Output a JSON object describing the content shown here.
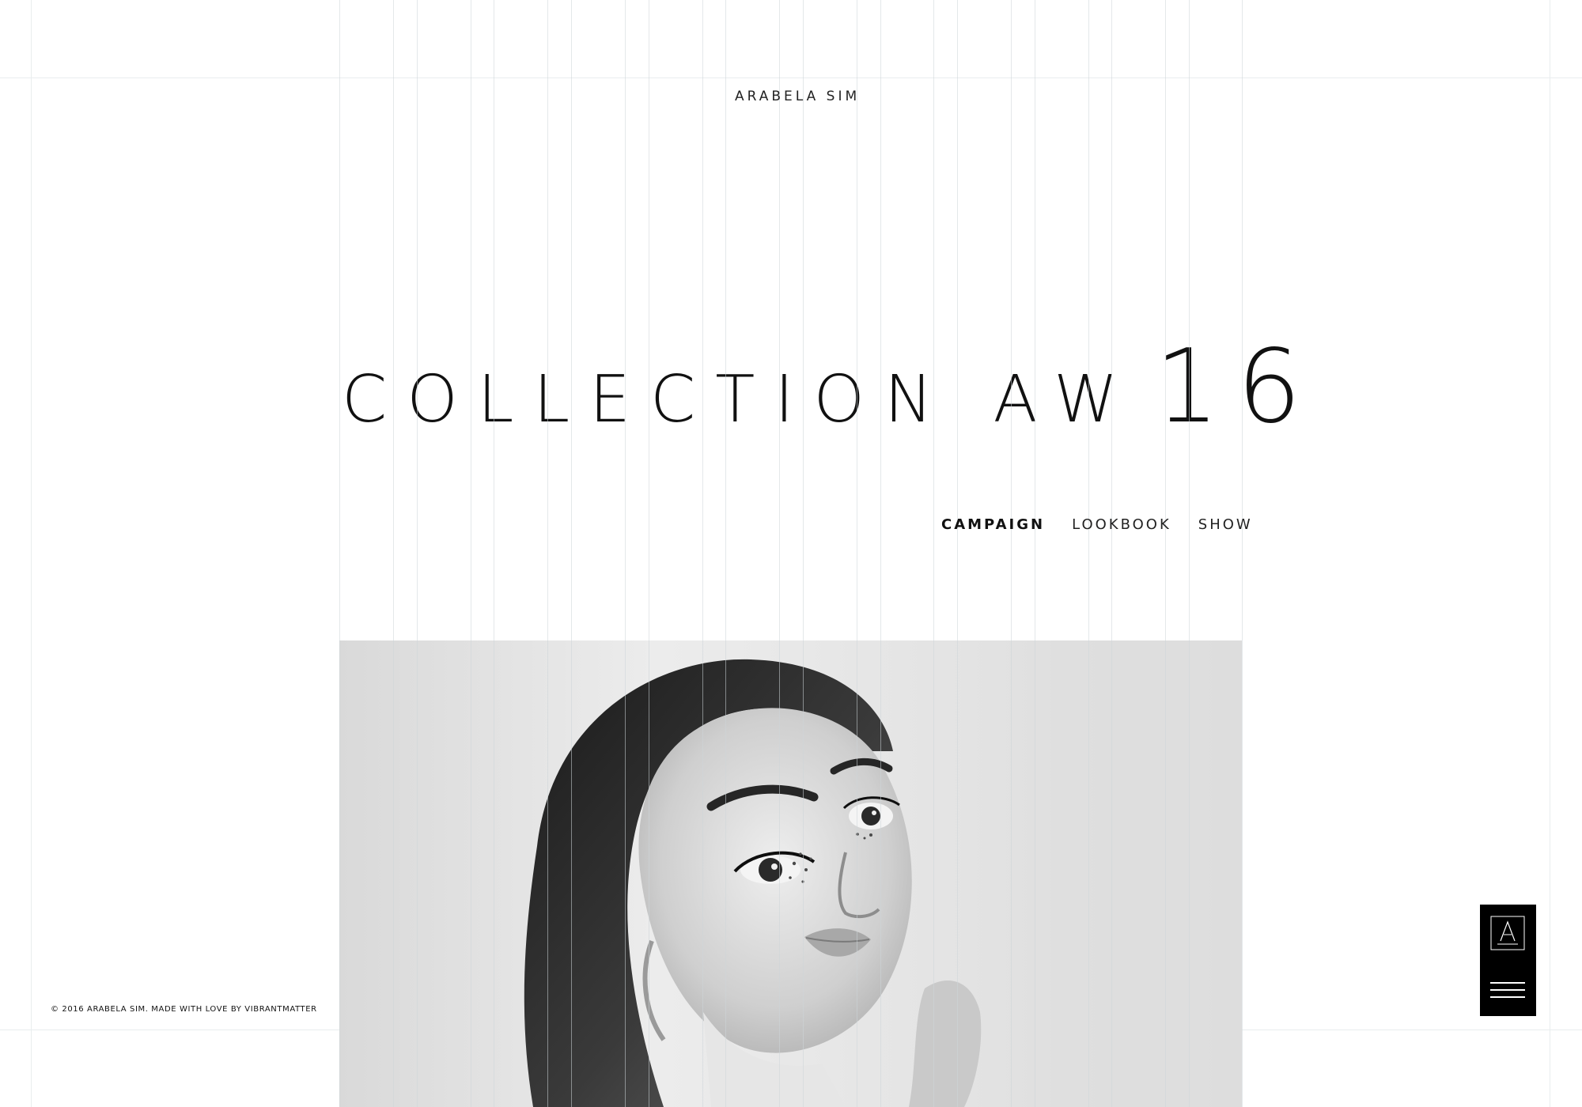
{
  "brand": {
    "name": "ARABELA SIM"
  },
  "hero_title": {
    "words": "COLLECTION AW",
    "number": "16"
  },
  "section_nav": {
    "items": [
      {
        "label": "CAMPAIGN",
        "active": true
      },
      {
        "label": "LOOKBOOK",
        "active": false
      },
      {
        "label": "SHOW",
        "active": false
      }
    ]
  },
  "footer": {
    "text": "© 2016 ARABELA SIM. MADE WITH  LOVE BY VIBRANTMATTER"
  },
  "menu_widget": {
    "logo_icon": "arabela-a-logo-icon",
    "menu_icon": "hamburger-menu-icon"
  },
  "hero_image": {
    "subject": "black and white portrait of a woman with glitter eye makeup"
  },
  "colors": {
    "background": "#ffffff",
    "text": "#111111",
    "grid_line": "#e3e8e9",
    "menu_widget": "#000000"
  }
}
